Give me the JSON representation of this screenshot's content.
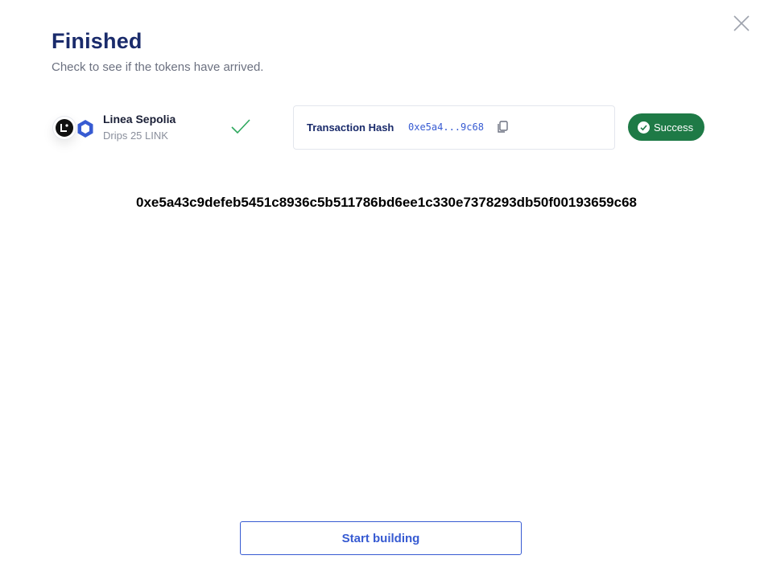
{
  "dialog": {
    "title": "Finished",
    "subtitle": "Check to see if the tokens have arrived."
  },
  "network": {
    "name": "Linea Sepolia",
    "drips": "Drips 25 LINK",
    "icons": [
      "linea-logo-icon",
      "chainlink-logo-icon"
    ]
  },
  "transaction": {
    "label": "Transaction Hash",
    "hash_short": "0xe5a4...9c68",
    "status": "Success",
    "full_hash": "0xe5a43c9defeb5451c8936c5b511786bd6ee1c330e7378293db50f00193659c68"
  },
  "actions": {
    "start_building": "Start building"
  },
  "colors": {
    "title": "#1a2b6b",
    "accent": "#375bd2",
    "success": "#1e7a46",
    "check": "#2ea85e"
  }
}
